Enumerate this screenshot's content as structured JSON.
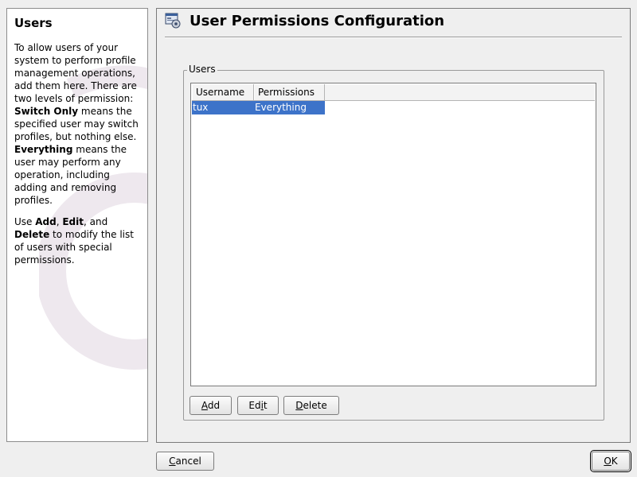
{
  "help": {
    "title": "Users",
    "para1": [
      {
        "text": "To allow users of your system to perform profile management operations, add them here. There are two levels of permission: ",
        "bold": false
      },
      {
        "text": "Switch Only",
        "bold": true
      },
      {
        "text": " means the specified user may switch profiles, but nothing else. ",
        "bold": false
      },
      {
        "text": "Everything",
        "bold": true
      },
      {
        "text": " means the user may perform any operation, including adding and removing profiles.",
        "bold": false
      }
    ],
    "para2": [
      {
        "text": "Use ",
        "bold": false
      },
      {
        "text": "Add",
        "bold": true
      },
      {
        "text": ", ",
        "bold": false
      },
      {
        "text": "Edit",
        "bold": true
      },
      {
        "text": ", and ",
        "bold": false
      },
      {
        "text": "Delete",
        "bold": true
      },
      {
        "text": " to modify the list of users with special permissions.",
        "bold": false
      }
    ]
  },
  "header": {
    "title": "User Permissions Configuration",
    "icon": "config-window-icon"
  },
  "users_group": {
    "legend": "Users",
    "columns": [
      "Username",
      "Permissions"
    ],
    "rows": [
      {
        "username": "tux",
        "permissions": "Everything",
        "selected": true
      }
    ],
    "buttons": {
      "add": {
        "pre": "",
        "mn": "A",
        "post": "dd"
      },
      "edit": {
        "pre": "Ed",
        "mn": "i",
        "post": "t"
      },
      "delete": {
        "pre": "",
        "mn": "D",
        "post": "elete"
      }
    }
  },
  "footer": {
    "cancel": {
      "pre": "",
      "mn": "C",
      "post": "ancel"
    },
    "ok": {
      "pre": "",
      "mn": "O",
      "post": "K"
    }
  },
  "colors": {
    "selection": "#3d73c9",
    "background": "#efefef"
  }
}
